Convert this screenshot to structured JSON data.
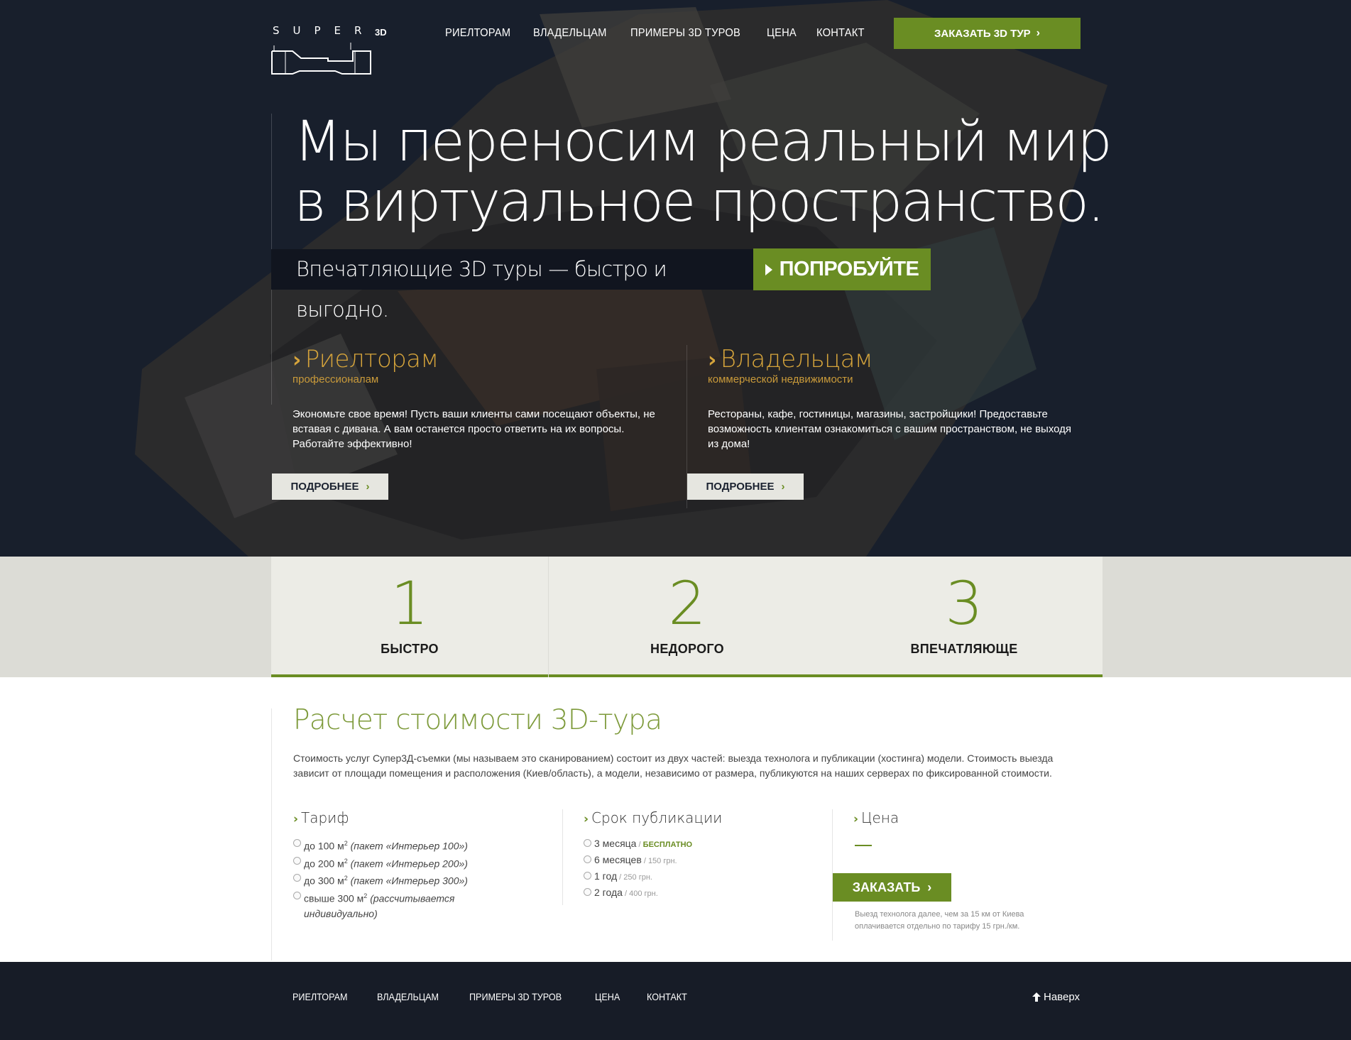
{
  "header": {
    "logo_letters": "SUPER",
    "logo_3d": "3D",
    "nav": [
      "РИЕЛТОРАМ",
      "ВЛАДЕЛЬЦАМ",
      "ПРИМЕРЫ 3D ТУРОВ",
      "ЦЕНА",
      "КОНТАКТ"
    ],
    "order_tour_label": "ЗАКАЗАТЬ 3D ТУР"
  },
  "hero": {
    "headline_line1": "Мы переносим реальный мир",
    "headline_line2": "в виртуальное пространство.",
    "tagline": "Впечатляющие 3D туры — быстро и выгодно.",
    "try_label": "ПОПРОБУЙТЕ"
  },
  "audiences": [
    {
      "title": "Риелторам",
      "subtitle": "профессионалам",
      "text": "Экономьте свое время! Пусть ваши клиенты сами посещают объекты, не вставая с дивана. А вам останется просто ответить на их вопросы. Работайте эффективно!",
      "button": "ПОДРОБНЕЕ"
    },
    {
      "title": "Владельцам",
      "subtitle": "коммерческой недвижимости",
      "text": "Рестораны, кафе, гостиницы, магазины, застройщики! Предоставьте возможность клиентам ознакомиться с вашим пространством, не выходя из дома!",
      "button": "ПОДРОБНЕЕ"
    }
  ],
  "features": [
    {
      "num": "1",
      "label": "БЫСТРО"
    },
    {
      "num": "2",
      "label": "НЕДОРОГО"
    },
    {
      "num": "3",
      "label": "ВПЕЧАТЛЯЮЩЕ"
    }
  ],
  "pricing": {
    "title": "Расчет стоимости 3D-тура",
    "description": "Стоимость услуг Супер3Д-съемки (мы называем это сканированием) состоит из двух частей: выезда технолога и публикации (хостинга) модели. Стоимость выезда зависит от площади помещения и расположения (Киев/область), а модели, независимо от размера, публикуются на наших серверах по фиксированной стоимости.",
    "tariff_title": "Тариф",
    "tariffs": [
      {
        "area": "до 100 м",
        "sup": "2",
        "pkg": "(пакет «Интерьер 100»)"
      },
      {
        "area": "до 200 м",
        "sup": "2",
        "pkg": "(пакет «Интерьер 200»)"
      },
      {
        "area": "до 300 м",
        "sup": "2",
        "pkg": "(пакет «Интерьер 300»)"
      },
      {
        "area": "свыше 300 м",
        "sup": "2",
        "pkg": "(рассчитывается индивидуально)"
      }
    ],
    "term_title": "Срок публикации",
    "terms": [
      {
        "label": "3 месяца",
        "sep": " / ",
        "price": "БЕСПЛАТНО"
      },
      {
        "label": "6 месяцев",
        "sep": " / ",
        "price": "150 грн."
      },
      {
        "label": "1 год",
        "sep": " / ",
        "price": "250 грн."
      },
      {
        "label": "2 года",
        "sep": " / ",
        "price": "400 грн."
      }
    ],
    "price_title": "Цена",
    "order_label": "ЗАКАЗАТЬ",
    "note": "Выезд технолога далее, чем за 15 км от Киева оплачивается отдельно по тарифу 15 грн./км."
  },
  "footer": {
    "nav": [
      "РИЕЛТОРАМ",
      "ВЛАДЕЛЬЦАМ",
      "ПРИМЕРЫ 3D ТУРОВ",
      "ЦЕНА",
      "КОНТАКТ"
    ],
    "to_top": "Наверх"
  },
  "colors": {
    "accent_green": "#6a8d23",
    "gold": "#d6a43b",
    "dark_navy": "#1b2230"
  }
}
